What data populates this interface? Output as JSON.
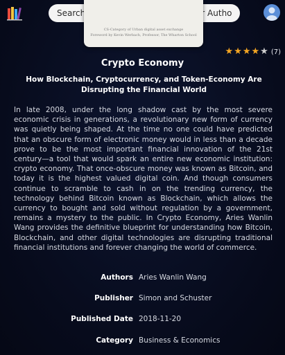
{
  "search": {
    "placeholder": "Search For Book Here Witht Title Or Author"
  },
  "icons": {
    "logo": "books-logo-icon",
    "avatar": "user-avatar-icon"
  },
  "colors": {
    "star": "#f5a623",
    "avatar": "#5b8fd8"
  },
  "cover": {
    "line1": "CS-Category of Urban digital asset exchange",
    "line2": "Foreword by Kevin Werbach, Professor, The Wharton School"
  },
  "rating": {
    "value": 4,
    "max": 5,
    "count_label": "(7)"
  },
  "book": {
    "title": "Crypto Economy",
    "subtitle": "How Blockchain, Cryptocurrency, and Token-Economy Are Disrupting the Financial World",
    "description": "In late 2008, under the long shadow cast by the most severe economic crisis in generations, a revolutionary new form of currency was quietly being shaped. At the time no one could have predicted that an obscure form of electronic money would in less than a decade prove to be the most important financial innovation of the 21st century—a tool that would spark an entire new economic institution: crypto economy. That once-obscure money was known as Bitcoin, and today it is the highest valued digital coin. And though consumers continue to scramble to cash in on the trending currency, the technology behind Bitcoin known as Blockchain, which allows the currency to bought and sold without regulation by a government, remains a mystery to the public. In Crypto Economy, Aries Wanlin Wang provides the definitive blueprint for understanding how Bitcoin, Blockchain, and other digital technologies are disrupting traditional financial institutions and forever changing the world of commerce."
  },
  "details": [
    {
      "label": "Authors",
      "value": "Aries Wanlin Wang"
    },
    {
      "label": "Publisher",
      "value": "Simon and Schuster"
    },
    {
      "label": "Published Date",
      "value": "2018-11-20"
    },
    {
      "label": "Category",
      "value": "Business & Economics"
    }
  ]
}
